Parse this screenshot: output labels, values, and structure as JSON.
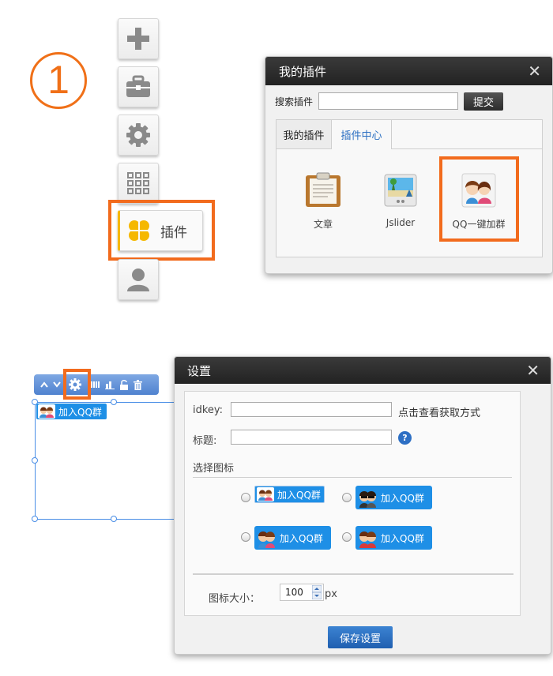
{
  "step": {
    "number": "1"
  },
  "toolbar": {
    "items": [
      {
        "icon": "plus-icon"
      },
      {
        "icon": "toolbox-icon"
      },
      {
        "icon": "gear-icon"
      },
      {
        "icon": "grid-icon"
      },
      {
        "icon": "clover-icon",
        "label": "插件"
      },
      {
        "icon": "user-icon"
      }
    ]
  },
  "plugin_dialog": {
    "title": "我的插件",
    "close": "✕",
    "search_label": "搜索插件",
    "search_value": "",
    "submit_label": "提交",
    "tabs": [
      {
        "label": "我的插件"
      },
      {
        "label": "插件中心",
        "active": true
      }
    ],
    "items": [
      {
        "label": "文章",
        "icon": "clipboard-icon"
      },
      {
        "label": "Jslider",
        "icon": "slider-image-icon"
      },
      {
        "label": "QQ一键加群",
        "icon": "qq-group-icon"
      }
    ]
  },
  "editor": {
    "toolbar_icons": [
      "arrow-up-icon",
      "arrow-down-icon",
      "gear-icon",
      "columns-icon",
      "chart-icon",
      "unlock-icon",
      "trash-icon"
    ],
    "widget_label": "加入QQ群"
  },
  "settings_dialog": {
    "title": "设置",
    "close": "✕",
    "idkey_label": "idkey:",
    "idkey_value": "",
    "idkey_help": "点击查看获取方式",
    "title_label": "标题:",
    "title_value": "",
    "help_icon": "?",
    "choose_icon_label": "选择图标",
    "icon_options": [
      {
        "label": "加入QQ群"
      },
      {
        "label": "加入QQ群"
      },
      {
        "label": "加入QQ群"
      },
      {
        "label": "加入QQ群"
      }
    ],
    "size_label": "图标大小：",
    "size_value": "100",
    "size_unit": "px",
    "save_label": "保存设置"
  },
  "colors": {
    "highlight": "#f26b1d",
    "accent_blue": "#1e8fe6",
    "step_orange": "#f07018"
  }
}
